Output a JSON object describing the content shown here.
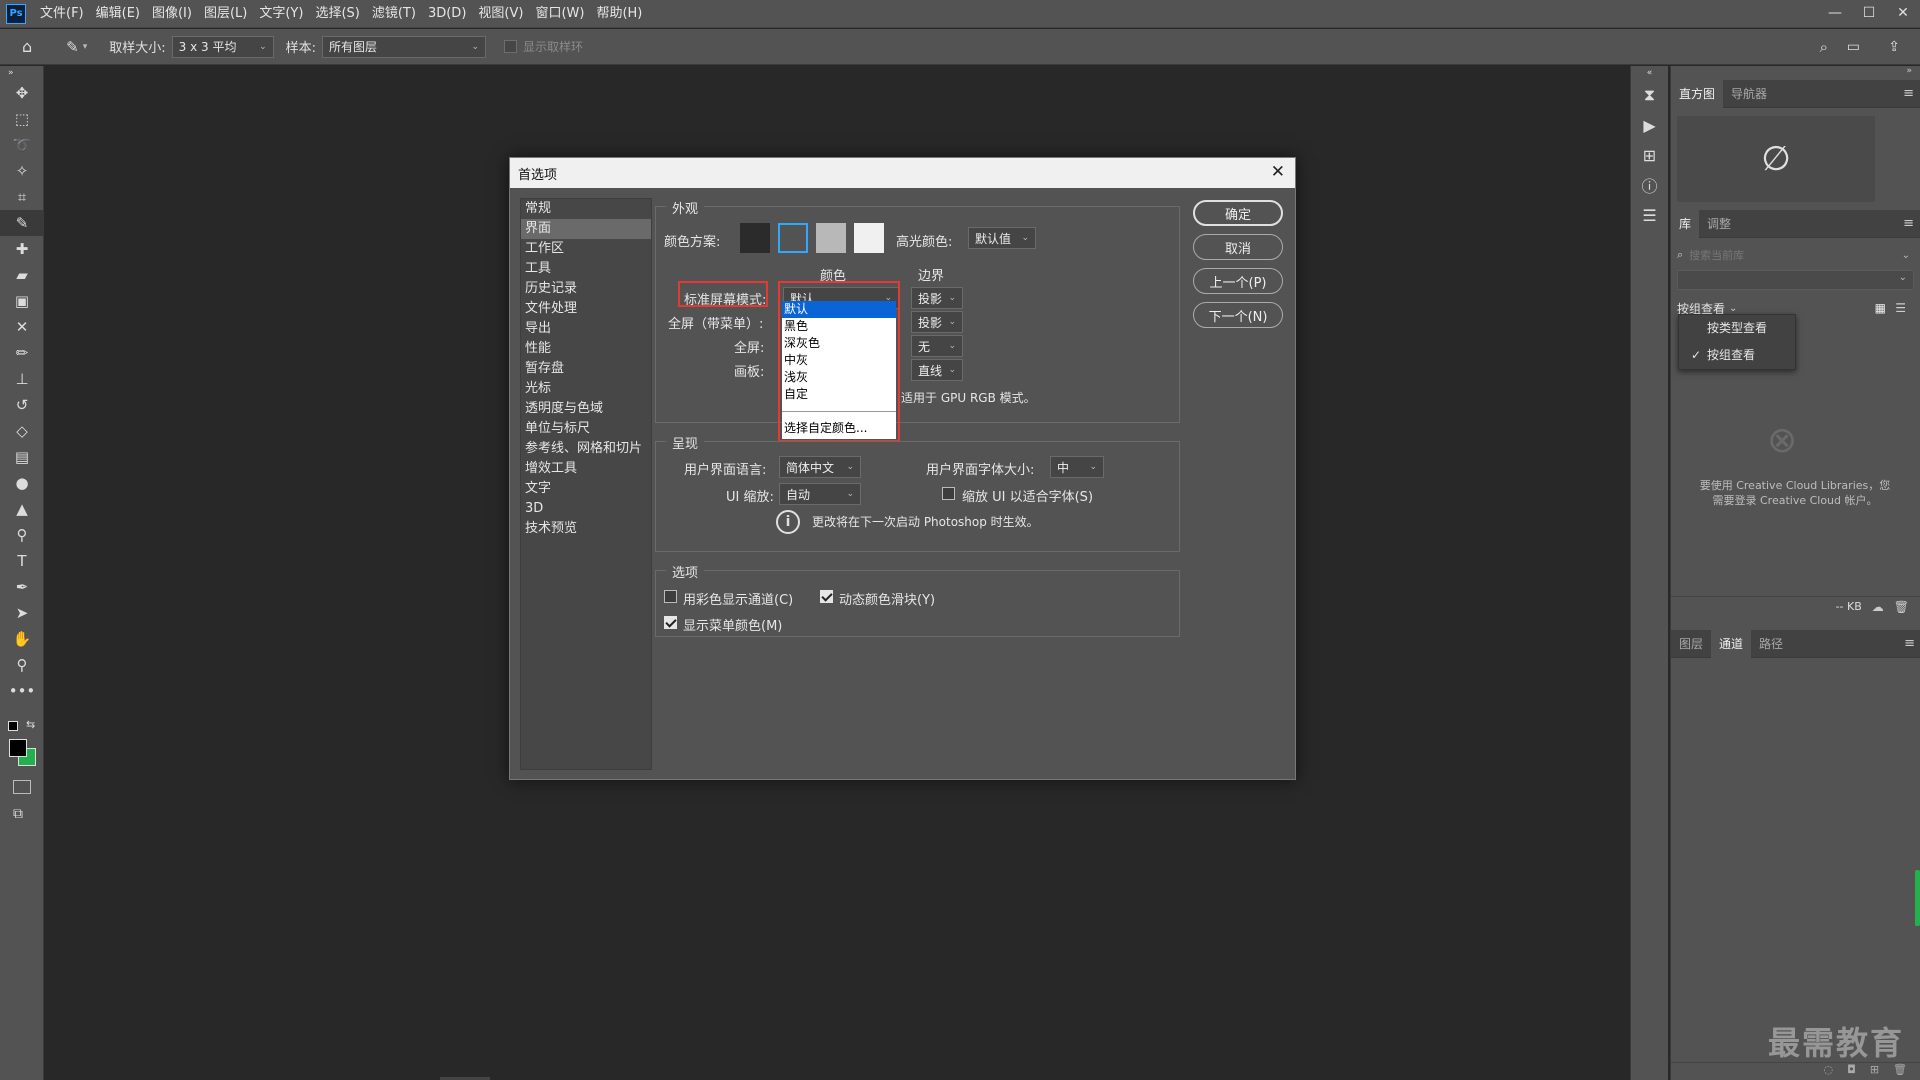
{
  "menubar": {
    "logo": "Ps",
    "items": [
      "文件(F)",
      "编辑(E)",
      "图像(I)",
      "图层(L)",
      "文字(Y)",
      "选择(S)",
      "滤镜(T)",
      "3D(D)",
      "视图(V)",
      "窗口(W)",
      "帮助(H)"
    ],
    "controls": [
      "—",
      "☐",
      "✕"
    ]
  },
  "options": {
    "sample_size_label": "取样大小:",
    "sample_size_value": "3 x 3 平均",
    "sample_label": "样本:",
    "sample_value": "所有图层",
    "show_ring": "显示取样环"
  },
  "dialog": {
    "title": "首选项",
    "categories": [
      "常规",
      "界面",
      "工作区",
      "工具",
      "历史记录",
      "文件处理",
      "导出",
      "性能",
      "暂存盘",
      "光标",
      "透明度与色域",
      "单位与标尺",
      "参考线、网格和切片",
      "增效工具",
      "文字",
      "3D",
      "技术预览"
    ],
    "selected_category": "界面",
    "appearance": {
      "title": "外观",
      "color_scheme_label": "颜色方案:",
      "highlight_label": "高光颜色:",
      "highlight_value": "默认值",
      "col_color": "颜色",
      "col_border": "边界",
      "rows": [
        {
          "label": "标准屏幕模式:",
          "color": "默认",
          "border": "投影"
        },
        {
          "label": "全屏（带菜单）:",
          "color": "",
          "border": "投影"
        },
        {
          "label": "全屏:",
          "color": "",
          "border": "无"
        },
        {
          "label": "画板:",
          "color": "",
          "border": "直线"
        }
      ],
      "gpu_note": "适用于 GPU RGB 模式。"
    },
    "dropdown_options": [
      "默认",
      "黑色",
      "深灰色",
      "中灰",
      "浅灰",
      "自定"
    ],
    "dropdown_custom": "选择自定颜色...",
    "presentation": {
      "title": "呈现",
      "lang_label": "用户界面语言:",
      "lang_value": "简体中文",
      "fontsize_label": "用户界面字体大小:",
      "fontsize_value": "中",
      "scale_label": "UI 缩放:",
      "scale_value": "自动",
      "scale_fit_label": "缩放 UI 以适合字体(S)",
      "restart_note": "更改将在下一次启动 Photoshop 时生效。"
    },
    "options_group": {
      "title": "选项",
      "color_channels": "用彩色显示通道(C)",
      "dynamic_sliders": "动态颜色滑块(Y)",
      "menu_colors": "显示菜单颜色(M)"
    },
    "buttons": {
      "ok": "确定",
      "cancel": "取消",
      "prev": "上一个(P)",
      "next": "下一个(N)"
    }
  },
  "right_panel": {
    "tabs_top": [
      "直方图",
      "导航器"
    ],
    "tabs_lib": [
      "库",
      "调整"
    ],
    "search_placeholder": "搜索当前库",
    "group_view": "按组查看",
    "view_menu": [
      "按类型查看",
      "按组查看"
    ],
    "cc_message": "要使用 Creative Cloud Libraries，您需要登录 Creative Cloud 帐户。",
    "kb": "-- KB",
    "tabs_bottom": [
      "图层",
      "通道",
      "路径"
    ]
  },
  "watermark": "最需教育"
}
